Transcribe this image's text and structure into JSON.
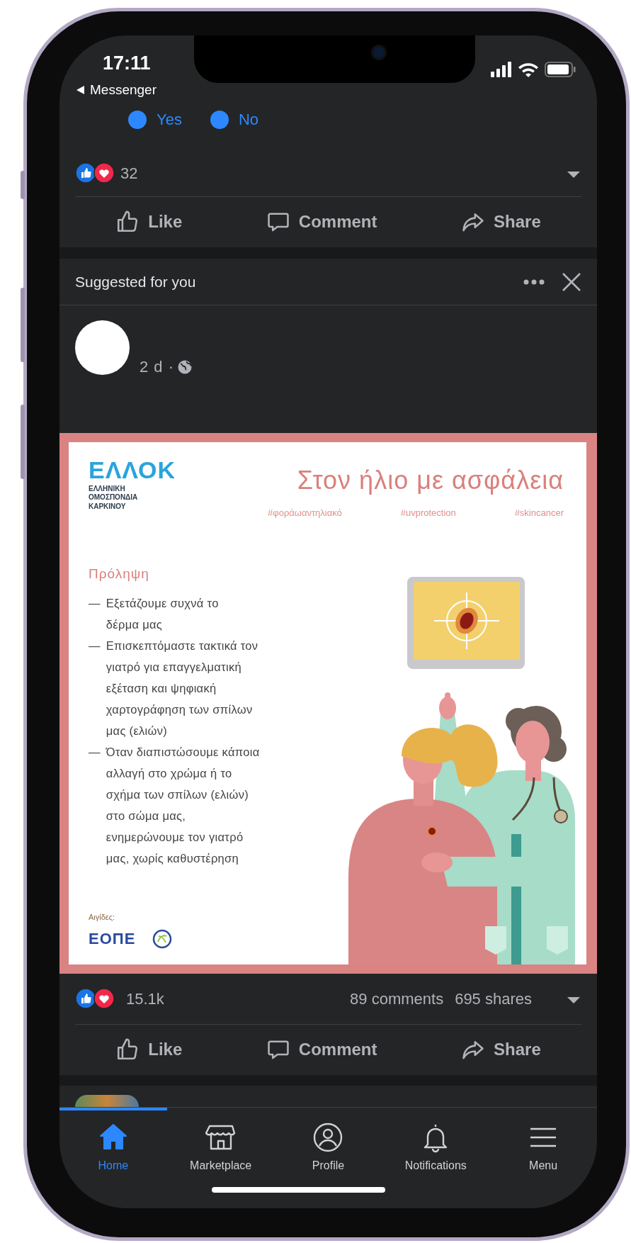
{
  "status_bar": {
    "time": "17:11",
    "back_label": "Messenger"
  },
  "previous_post": {
    "poll_options": [
      {
        "label": "Yes"
      },
      {
        "label": "No"
      }
    ],
    "reaction_count": "32",
    "actions": [
      {
        "kind": "like",
        "label": "Like"
      },
      {
        "kind": "comment",
        "label": "Comment"
      },
      {
        "kind": "share",
        "label": "Share"
      }
    ]
  },
  "suggested_post": {
    "header": "Suggested for you",
    "time": "2 d ·",
    "image": {
      "logo": {
        "name": "ΕΛΛΟΚ",
        "subtitle_lines": [
          "ΕΛΛΗΝΙΚΗ",
          "ΟΜΟΣΠΟΝΔΙΑ",
          "ΚΑΡΚΙΝΟΥ"
        ]
      },
      "title": "Στον ήλιο με ασφάλεια",
      "hashtags": [
        "#φοράωαντηλιακό",
        "#uvprotection",
        "#skincancer"
      ],
      "heading": "Πρόληψη",
      "bullets": [
        {
          "marker": "—",
          "lines": [
            "Εξετάζουμε συχνά το",
            "δέρμα μας"
          ]
        },
        {
          "marker": "—",
          "lines": [
            "Επισκεπτόμαστε τακτικά τον",
            "γιατρό για επαγγελματική",
            "εξέταση και ψηφιακή",
            "χαρτογράφηση των σπίλων",
            "μας (ελιών)"
          ]
        },
        {
          "marker": "—",
          "lines": [
            "Όταν διαπιστώσουμε κάποια",
            "αλλαγή στο χρώμα ή το",
            "σχήμα των σπίλων (ελιών)",
            "στο σώμα μας,",
            "ενημερώνουμε τον γιατρό",
            "μας, χωρίς καθυστέρηση"
          ]
        }
      ],
      "patronage_label": "Αιγίδες:",
      "sponsor_logo": "ΕΟΠΕ"
    },
    "reaction_count": "15.1k",
    "comments": "89 comments",
    "shares": "695 shares",
    "actions": [
      {
        "kind": "like",
        "label": "Like"
      },
      {
        "kind": "comment",
        "label": "Comment"
      },
      {
        "kind": "share",
        "label": "Share"
      }
    ]
  },
  "tab_bar": [
    {
      "kind": "home",
      "label": "Home",
      "selected": true
    },
    {
      "kind": "marketplace",
      "label": "Marketplace",
      "selected": false
    },
    {
      "kind": "profile",
      "label": "Profile",
      "selected": false
    },
    {
      "kind": "notifications",
      "label": "Notifications",
      "selected": false
    },
    {
      "kind": "menu",
      "label": "Menu",
      "selected": false
    }
  ]
}
